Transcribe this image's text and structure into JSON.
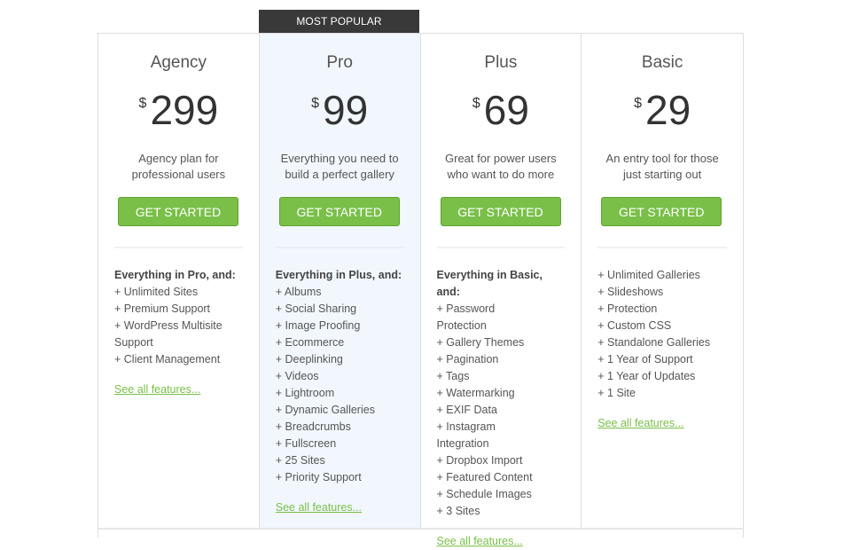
{
  "badge": "MOST POPULAR",
  "colors": {
    "accent_green": "#79bf48",
    "badge_bg": "#393939",
    "featured_bg": "#f2f7fd",
    "border": "#dedede"
  },
  "plans": [
    {
      "name": "Agency",
      "currency": "$",
      "price": "299",
      "description": "Agency plan for professional users",
      "button": "GET STARTED",
      "features_heading": "Everything in Pro, and:",
      "features": [
        "+ Unlimited Sites",
        "+ Premium Support",
        "+ WordPress Multisite Support",
        "+ Client Management"
      ],
      "link": "See all features..."
    },
    {
      "name": "Pro",
      "currency": "$",
      "price": "99",
      "description": "Everything you need to build a perfect gallery",
      "button": "GET STARTED",
      "features_heading": "Everything in Plus, and:",
      "features": [
        "+ Albums",
        "+ Social Sharing",
        "+ Image Proofing",
        "+ Ecommerce",
        "+ Deeplinking",
        "+ Videos",
        "+ Lightroom",
        "+ Dynamic Galleries",
        "+ Breadcrumbs",
        "+ Fullscreen",
        "+ 25 Sites",
        "+ Priority Support"
      ],
      "link": "See all features..."
    },
    {
      "name": "Plus",
      "currency": "$",
      "price": "69",
      "description": "Great for power users who want to do more",
      "button": "GET STARTED",
      "features_heading": "Everything in Basic, and:",
      "features": [
        "+ Password Protection",
        "+ Gallery Themes",
        "+ Pagination",
        "+ Tags",
        "+ Watermarking",
        "+ EXIF Data",
        "+ Instagram Integration",
        "+ Dropbox Import",
        "+ Featured Content",
        "+ Schedule Images",
        "+ 3 Sites"
      ],
      "link": "See all features..."
    },
    {
      "name": "Basic",
      "currency": "$",
      "price": "29",
      "description": "An entry tool for those just starting out",
      "button": "GET STARTED",
      "features_heading": "",
      "features": [
        "+ Unlimited Galleries",
        "+ Slideshows",
        "+ Protection",
        "+ Custom CSS",
        "+ Standalone Galleries",
        "+ 1 Year of Support",
        "+ 1 Year of Updates",
        "+ 1 Site"
      ],
      "link": "See all features..."
    }
  ]
}
